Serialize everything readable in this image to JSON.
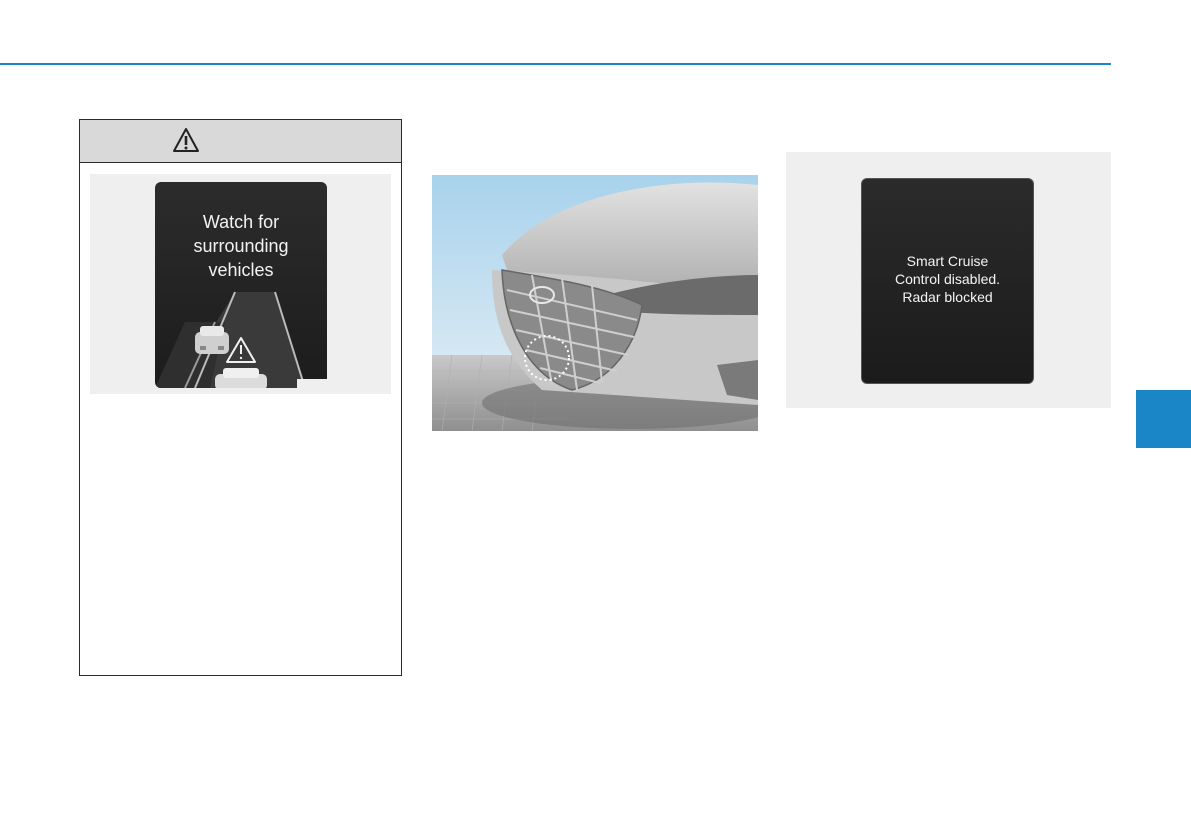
{
  "layout": {
    "accent_color": "#1a86c8"
  },
  "warning_box": {
    "header_icon": "warning-triangle-icon",
    "illustration": {
      "message": "Watch for\nsurrounding\nvehicles",
      "road_icon": "warning-triangle-icon"
    }
  },
  "photo": {
    "subject": "car-front-bumper-radar-sensor"
  },
  "cluster_display": {
    "message": "Smart Cruise\nControl disabled.\nRadar blocked"
  }
}
